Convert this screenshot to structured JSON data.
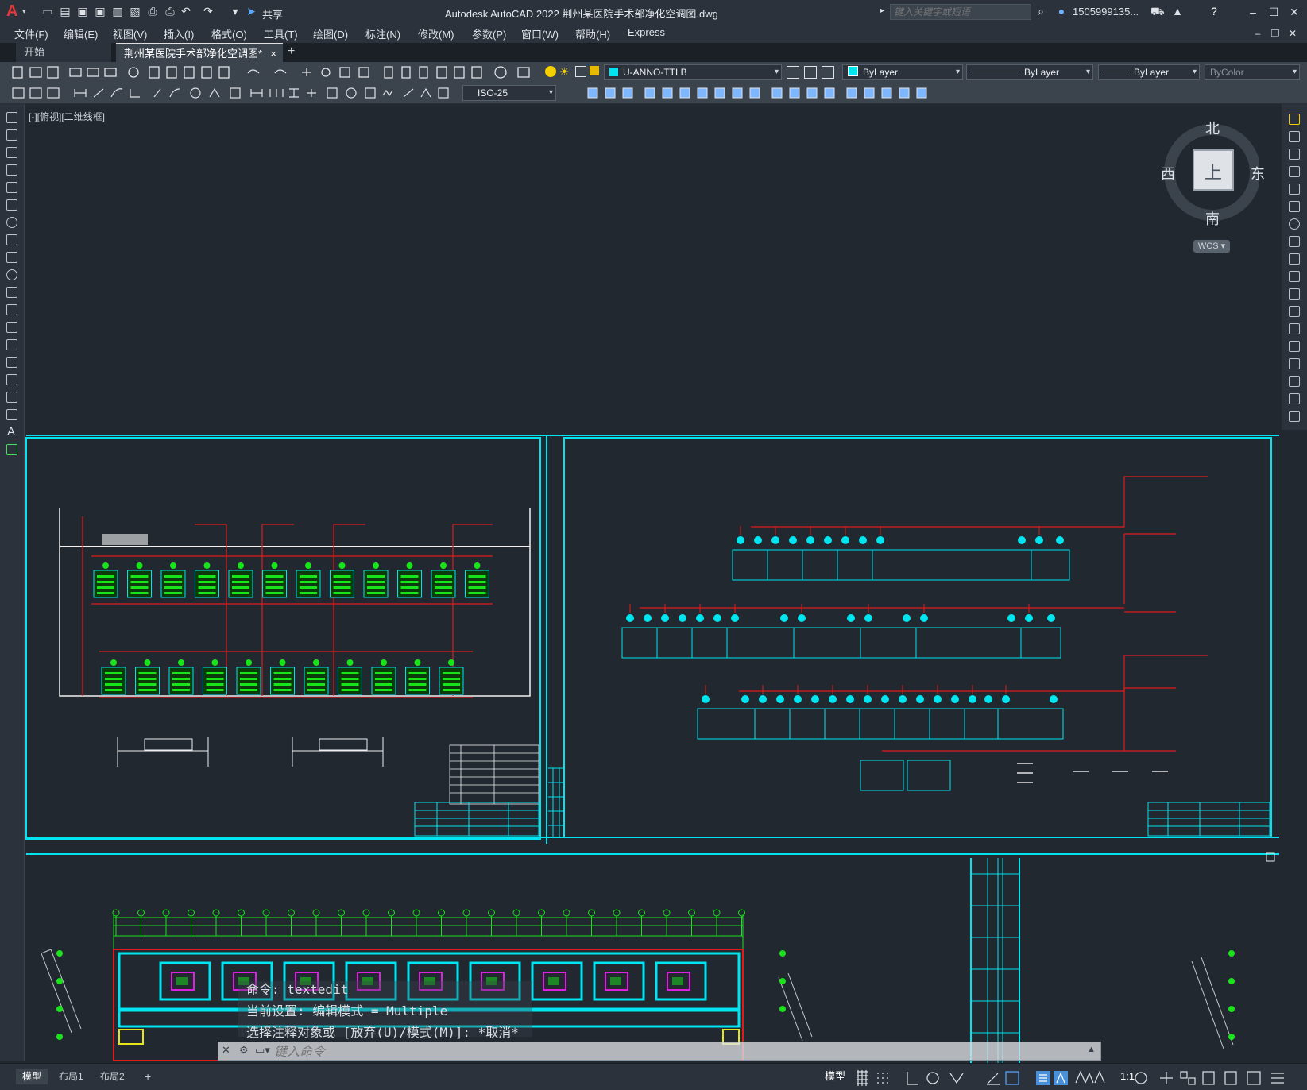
{
  "app": {
    "logo": "A",
    "title": "Autodesk AutoCAD 2022    荆州某医院手术部净化空调图.dwg",
    "share_label": "共享"
  },
  "search": {
    "placeholder": "键入关键字或短语"
  },
  "user": {
    "name": "1505999135..."
  },
  "menu": [
    "文件(F)",
    "编辑(E)",
    "视图(V)",
    "插入(I)",
    "格式(O)",
    "工具(T)",
    "绘图(D)",
    "标注(N)",
    "修改(M)",
    "参数(P)",
    "窗口(W)",
    "帮助(H)",
    "Express"
  ],
  "tabs": {
    "start": "开始",
    "drawing": "荆州某医院手术部净化空调图*",
    "close": "×",
    "add": "+"
  },
  "toolbar": {
    "layer": "U-ANNO-TTLB",
    "color": "ByLayer",
    "linetype": "ByLayer",
    "lineweight": "ByLayer",
    "plotstyle": "ByColor",
    "dimstyle": "ISO-25"
  },
  "viewport": {
    "label": "[-][俯视][二维线框]"
  },
  "viewcube": {
    "north": "北",
    "south": "南",
    "east": "东",
    "west": "西",
    "face": "上",
    "wcs": "WCS"
  },
  "command": {
    "line1": "命令:  textedit",
    "line2": "当前设置: 编辑模式 = Multiple",
    "line3": "选择注释对象或 [放弃(U)/模式(M)]: *取消*",
    "placeholder": "键入命令"
  },
  "status": {
    "tabs": [
      "模型",
      "布局1",
      "布局2"
    ],
    "add": "+",
    "model_label": "模型",
    "scale": "1:1"
  },
  "colors": {
    "cyan": "#00e5ef",
    "red": "#e01b1b",
    "green": "#19e419",
    "magenta": "#e020e0",
    "white": "#f0f0f0",
    "yellow": "#e5e519"
  }
}
